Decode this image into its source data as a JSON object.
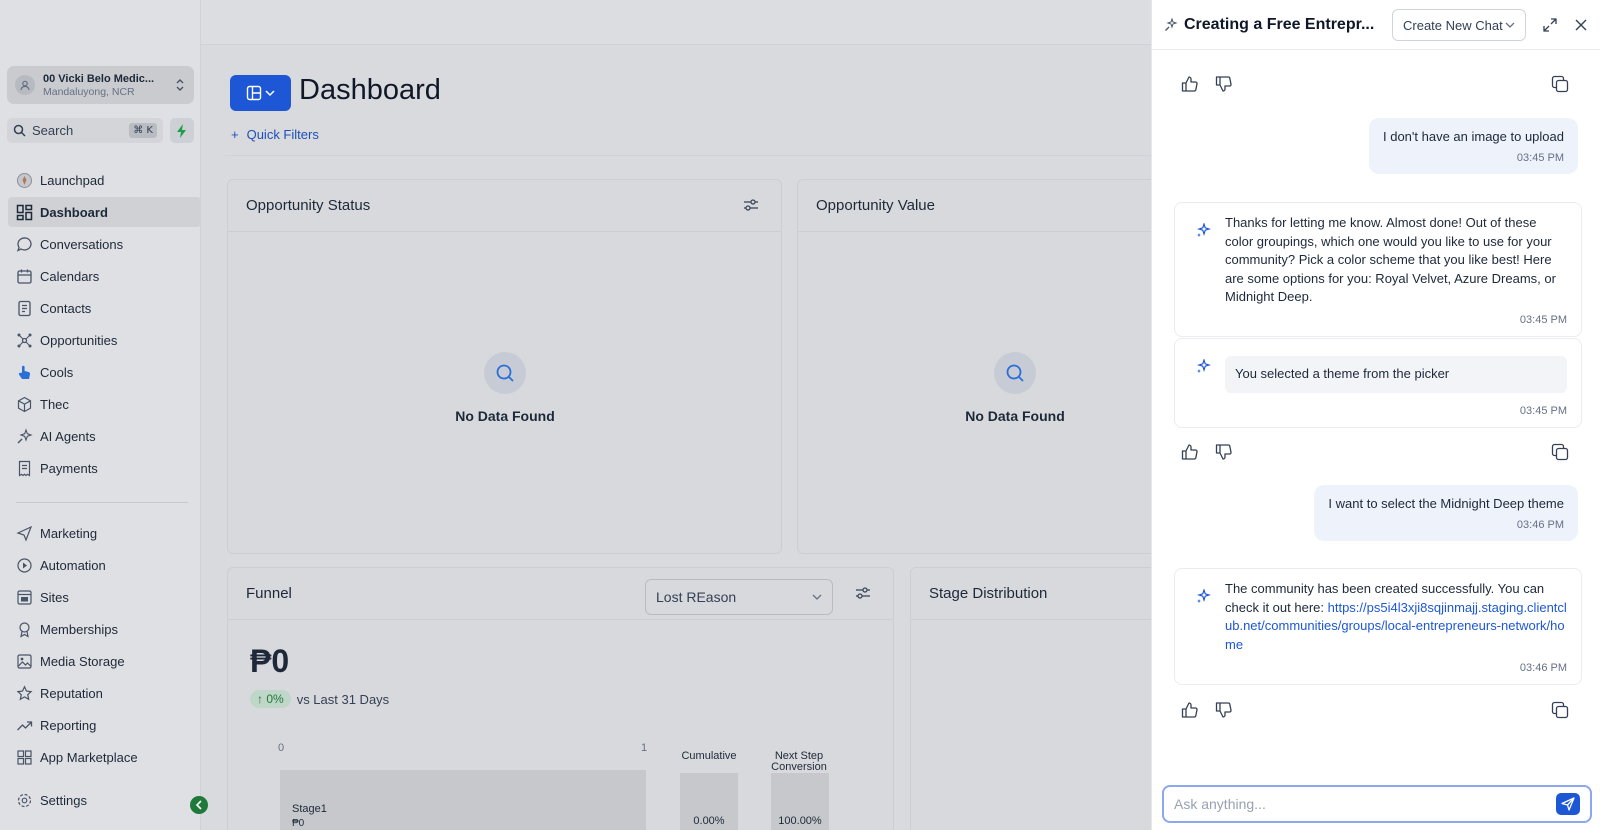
{
  "sidebar": {
    "account": {
      "name": "00 Vicki Belo Medic...",
      "location": "Mandaluyong, NCR"
    },
    "search": {
      "label": "Search",
      "shortcut": "⌘ K"
    },
    "items": [
      {
        "label": "Launchpad",
        "icon": "rocket-icon"
      },
      {
        "label": "Dashboard",
        "icon": "grid-icon"
      },
      {
        "label": "Conversations",
        "icon": "chat-bubble-icon"
      },
      {
        "label": "Calendars",
        "icon": "calendar-icon"
      },
      {
        "label": "Contacts",
        "icon": "contact-book-icon"
      },
      {
        "label": "Opportunities",
        "icon": "network-icon"
      },
      {
        "label": "Cools",
        "icon": "hand-pointer-icon"
      },
      {
        "label": "Thec",
        "icon": "cube-icon"
      },
      {
        "label": "AI Agents",
        "icon": "sparkle-icon"
      },
      {
        "label": "Payments",
        "icon": "receipt-icon"
      },
      {
        "label": "Marketing",
        "icon": "send-icon"
      },
      {
        "label": "Automation",
        "icon": "play-circle-icon"
      },
      {
        "label": "Sites",
        "icon": "browser-icon"
      },
      {
        "label": "Memberships",
        "icon": "award-icon"
      },
      {
        "label": "Media Storage",
        "icon": "image-icon"
      },
      {
        "label": "Reputation",
        "icon": "star-icon"
      },
      {
        "label": "Reporting",
        "icon": "trend-icon"
      },
      {
        "label": "App Marketplace",
        "icon": "apps-icon"
      },
      {
        "label": "Settings",
        "icon": "gear-icon"
      }
    ]
  },
  "main": {
    "title": "Dashboard",
    "quick_filters": "Quick Filters",
    "cards": {
      "opportunity_status": {
        "title": "Opportunity Status",
        "empty": "No Data Found"
      },
      "opportunity_value": {
        "title": "Opportunity Value",
        "empty": "No Data Found"
      },
      "funnel": {
        "title": "Funnel",
        "select_value": "Lost REason",
        "value": "₱0",
        "change": "↑ 0%",
        "change_label": "vs Last 31 Days",
        "axis_min": "0",
        "axis_max": "1",
        "stage": {
          "name": "Stage1",
          "value": "₱0"
        },
        "cumulative_label": "Cumulative",
        "next_step_label": "Next Step Conversion",
        "cumulative_value": "0.00%",
        "next_step_value": "100.00%"
      },
      "stage_distribution": {
        "title": "Stage Distribution"
      }
    }
  },
  "chat": {
    "title": "Creating a Free Entrepr...",
    "new_chat": "Create New Chat",
    "messages": {
      "user1": {
        "text": "I don't have an image to upload",
        "time": "03:45 PM"
      },
      "bot1": {
        "text": "Thanks for letting me know. Almost done! Out of these color groupings, which one would you like to use for your community? Pick a color scheme that you like best! Here are some options for you: Royal Velvet, Azure Dreams, or Midnight Deep.",
        "time": "03:45 PM"
      },
      "bot2": {
        "text": "You selected a theme from the picker",
        "time": "03:45 PM"
      },
      "user2": {
        "text": "I want to select the Midnight Deep theme",
        "time": "03:46 PM"
      },
      "bot3": {
        "text": "The community has been created successfully. You can check it out here:",
        "link": "https://ps5i4l3xji8sqjinmajj.staging.clientclub.net/communities/groups/local-entrepreneurs-network/home",
        "time": "03:46 PM"
      }
    },
    "input_placeholder": "Ask anything..."
  },
  "colors": {
    "accent": "#1d57d6",
    "success": "#1f7a3a",
    "user_bubble": "#eef2fb"
  }
}
